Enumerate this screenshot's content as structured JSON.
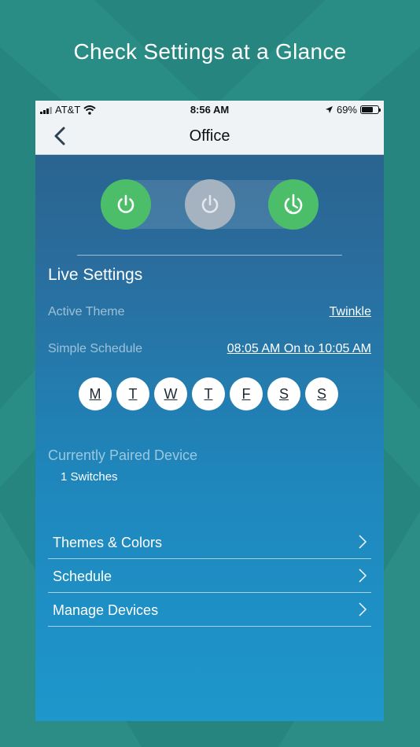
{
  "headline": "Check Settings at a Glance",
  "status_bar": {
    "carrier": "AT&T",
    "time": "8:56 AM",
    "battery_percent": "69%",
    "battery_level": 0.69
  },
  "nav": {
    "title": "Office"
  },
  "live_settings": {
    "title": "Live Settings",
    "active_theme_label": "Active Theme",
    "active_theme_value": "Twinkle",
    "schedule_label": "Simple Schedule",
    "schedule_value": "08:05 AM On to 10:05 AM"
  },
  "days": [
    "M",
    "T",
    "W",
    "T",
    "F",
    "S",
    "S"
  ],
  "paired": {
    "title": "Currently Paired Device",
    "count": "1 Switches"
  },
  "menu": [
    {
      "label": "Themes & Colors"
    },
    {
      "label": "Schedule"
    },
    {
      "label": "Manage Devices"
    }
  ],
  "colors": {
    "background": "#26857f",
    "power_on": "#4cbe6a",
    "power_off": "#a5b2bf"
  },
  "icons": {
    "back": "chevron-left-icon",
    "power": "power-icon",
    "timer": "power-timer-icon",
    "chevron": "chevron-right-icon"
  }
}
